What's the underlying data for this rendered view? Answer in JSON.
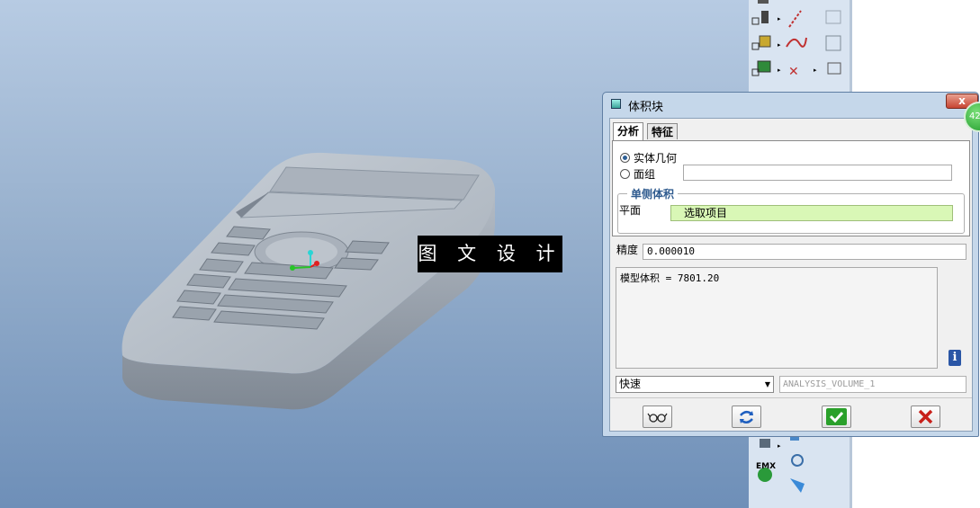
{
  "viewport": {
    "watermark": "图 文 设 计"
  },
  "dialog": {
    "title": "体积块",
    "close_label": "x",
    "tabs": [
      {
        "label": "分析",
        "active": true
      },
      {
        "label": "特征",
        "active": false
      }
    ],
    "geometry_options": [
      {
        "label": "实体几何",
        "selected": true
      },
      {
        "label": "面组",
        "selected": false
      }
    ],
    "group_title": "单侧体积",
    "plane_label": "平面",
    "plane_value": "选取项目",
    "precision_label": "精度",
    "precision_value": "0.000010",
    "result_text": "模型体积 = 7801.20",
    "mode_value": "快速",
    "analysis_name": "ANALYSIS_VOLUME_1"
  },
  "badge": {
    "label": "42"
  },
  "toolbar": {
    "emx_label": "EMX"
  },
  "colors": {
    "viewport_top": "#b7cbe3",
    "viewport_bottom": "#6e8fb8",
    "dialog_frame": "#c5d7ea",
    "accent_blue": "#2f5b8f",
    "select_field": "#d9f7b6",
    "ok_green": "#2aa02a",
    "cancel_red": "#c8201a"
  }
}
